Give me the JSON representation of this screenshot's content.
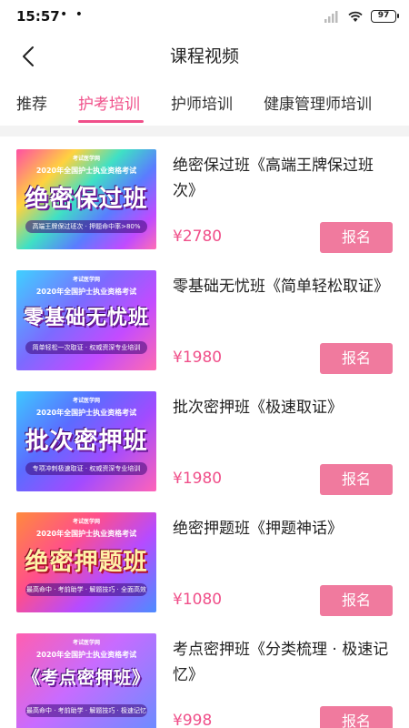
{
  "status_bar": {
    "time": "15:57",
    "dots": "• •",
    "battery": "97"
  },
  "header": {
    "title": "课程视频"
  },
  "tabs": [
    {
      "label": "推荐"
    },
    {
      "label": "护考培训"
    },
    {
      "label": "护师培训"
    },
    {
      "label": "健康管理师培训"
    }
  ],
  "active_tab": "护考培训",
  "accent_color": "#f0508a",
  "courses": [
    {
      "thumb_logo": "考试医学网",
      "thumb_sub": "2020年全国护士执业资格考试",
      "thumb_title": "绝密保过班",
      "thumb_caption": "高端王牌保过班次 · 押题命中率>80%",
      "name": "绝密保过班《高端王牌保过班次》",
      "price": "¥2780",
      "button": "报名"
    },
    {
      "thumb_logo": "考试医学网",
      "thumb_sub": "2020年全国护士执业资格考试",
      "thumb_title": "零基础无忧班",
      "thumb_caption": "简单轻松一次取证 · 权威资深专业培训",
      "name": "零基础无忧班《简单轻松取证》",
      "price": "¥1980",
      "button": "报名"
    },
    {
      "thumb_logo": "考试医学网",
      "thumb_sub": "2020年全国护士执业资格考试",
      "thumb_title": "批次密押班",
      "thumb_caption": "专项冲刺极速取证 · 权威资深专业培训",
      "name": "批次密押班《极速取证》",
      "price": "¥1980",
      "button": "报名"
    },
    {
      "thumb_logo": "考试医学网",
      "thumb_sub": "2020年全国护士执业资格考试",
      "thumb_title": "绝密押题班",
      "thumb_caption": "最高命中 · 考前助学 · 解题技巧 · 全面高效",
      "name": "绝密押题班《押题神话》",
      "price": "¥1080",
      "button": "报名"
    },
    {
      "thumb_logo": "考试医学网",
      "thumb_sub": "2020年全国护士执业资格考试",
      "thumb_title": "《考点密押班》",
      "thumb_caption": "最高命中 · 考前助学 · 解题技巧 · 极速记忆",
      "name": "考点密押班《分类梳理 · 极速记忆》",
      "price": "¥998",
      "button": "报名"
    }
  ]
}
